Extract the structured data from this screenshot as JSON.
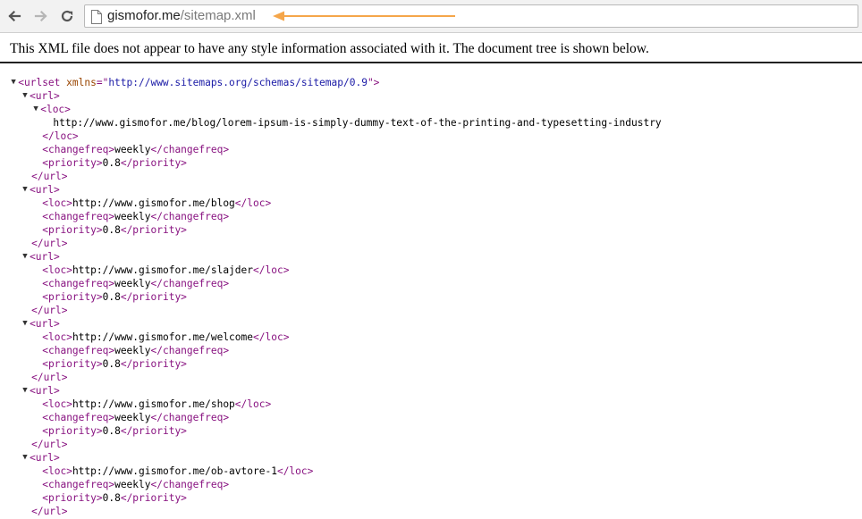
{
  "browser": {
    "url_host": "gismofor.me",
    "url_path": "/sitemap.xml",
    "accent_arrow_color": "#f5a64a",
    "icons": [
      "back-arrow-icon",
      "forward-arrow-icon",
      "reload-icon",
      "page-icon"
    ]
  },
  "info_text": "This XML file does not appear to have any style information associated with it. The document tree is shown below.",
  "xml_tree": {
    "urlset_open": "<urlset",
    "xmlns_attr": " xmlns",
    "xmlns_eq": "=\"",
    "xmlns_value": "http://www.sitemaps.org/schemas/sitemap/0.9",
    "xmlns_close": "\">",
    "url_open": "<url>",
    "url_close": "</url>",
    "loc_open": "<loc>",
    "loc_close": "</loc>",
    "changefreq_open": "<changefreq>",
    "changefreq_close": "</changefreq>",
    "priority_open": "<priority>",
    "priority_close": "</priority>",
    "urls": [
      {
        "loc": "http://www.gismofor.me/blog/lorem-ipsum-is-simply-dummy-text-of-the-printing-and-typesetting-industry",
        "changefreq": "weekly",
        "priority": "0.8"
      },
      {
        "loc": "http://www.gismofor.me/blog",
        "changefreq": "weekly",
        "priority": "0.8"
      },
      {
        "loc": "http://www.gismofor.me/slajder",
        "changefreq": "weekly",
        "priority": "0.8"
      },
      {
        "loc": "http://www.gismofor.me/welcome",
        "changefreq": "weekly",
        "priority": "0.8"
      },
      {
        "loc": "http://www.gismofor.me/shop",
        "changefreq": "weekly",
        "priority": "0.8"
      },
      {
        "loc": "http://www.gismofor.me/ob-avtore-1",
        "changefreq": "weekly",
        "priority": "0.8"
      }
    ]
  }
}
